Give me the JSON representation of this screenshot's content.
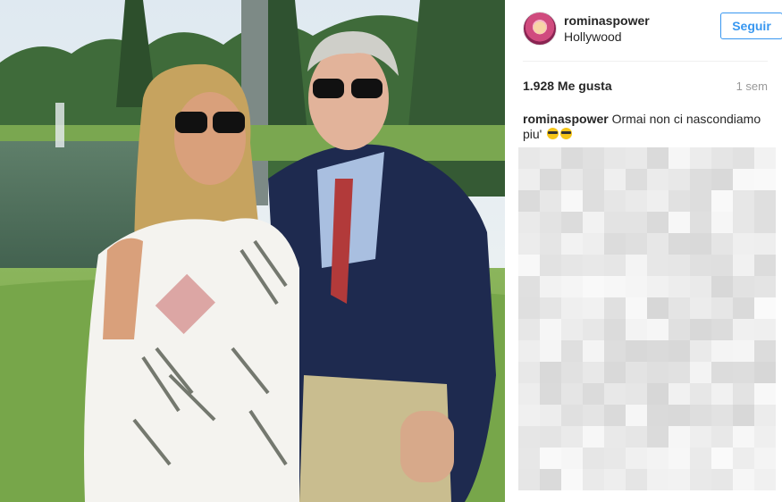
{
  "post": {
    "username": "rominaspower",
    "location": "Hollywood",
    "follow_label": "Seguir",
    "likes": "1.928 Me gusta",
    "time": "1 sem",
    "caption_user": "rominaspower",
    "caption_text": "Ormai non ci nascondiamo piu'",
    "caption_emoji": [
      "sunglasses-emoji",
      "sunglasses-emoji"
    ]
  },
  "colors": {
    "accent": "#3897f0",
    "text": "#262626",
    "muted": "#999999"
  }
}
